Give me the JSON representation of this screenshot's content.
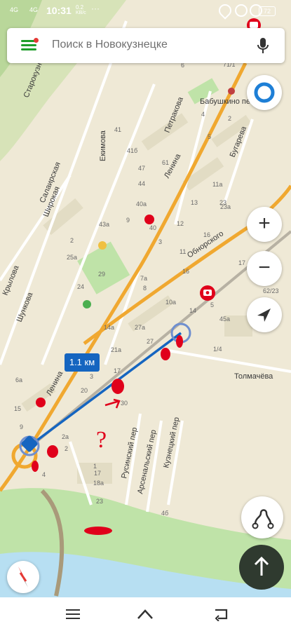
{
  "status_bar": {
    "signal_1": "4G",
    "signal_2": "4G",
    "time": "10:31",
    "speed_value": "0.2",
    "speed_unit": "KB/c",
    "dots": "···",
    "battery": "72"
  },
  "search": {
    "placeholder": "Поиск в Новокузнецке"
  },
  "route": {
    "distance_label": "1.1 км"
  },
  "map_labels": {
    "streets": [
      "Старокузн",
      "Екимова",
      "Петракова",
      "Бугарева",
      "Ленина",
      "Обнорского",
      "Салаирская",
      "Широкая",
      "Крылова",
      "Шункова",
      "Толмачёва",
      "Русинский пер",
      "Арсенальский пер",
      "Кузнецкий пер"
    ],
    "district": "Бабушкино пе",
    "house_numbers": [
      "71/1",
      "6",
      "5",
      "4",
      "2",
      "41",
      "47",
      "41б",
      "61",
      "44",
      "40а",
      "43а",
      "9",
      "40",
      "12",
      "3",
      "25а",
      "24",
      "29",
      "16",
      "7а",
      "8",
      "10а",
      "14",
      "14а",
      "27а",
      "21а",
      "27",
      "17",
      "3",
      "20",
      "6а",
      "45а",
      "1/4",
      "62/23",
      "15",
      "9",
      "2",
      "4",
      "1",
      "17",
      "18а",
      "23",
      "4б",
      "5",
      "17",
      "30",
      "11",
      "23",
      "13",
      "11а",
      "23а",
      "2",
      "16",
      "2а"
    ]
  },
  "annotations": {
    "question_mark": "?"
  },
  "controls": {
    "zoom_in": "+",
    "zoom_out": "−"
  },
  "colors": {
    "route": "#1565c0",
    "arterial_road": "#f0a830",
    "park": "#bfe3a8",
    "water": "#b7dff2",
    "marker_red": "#e0001b",
    "brand_green": "#1e9e2a"
  },
  "icons": [
    "menu-icon",
    "microphone-icon",
    "alice-icon",
    "compass-icon",
    "route-icon",
    "up-arrow-icon",
    "location-arrow-icon",
    "camera-icon",
    "back-icon",
    "home-icon",
    "recent-apps-icon"
  ]
}
